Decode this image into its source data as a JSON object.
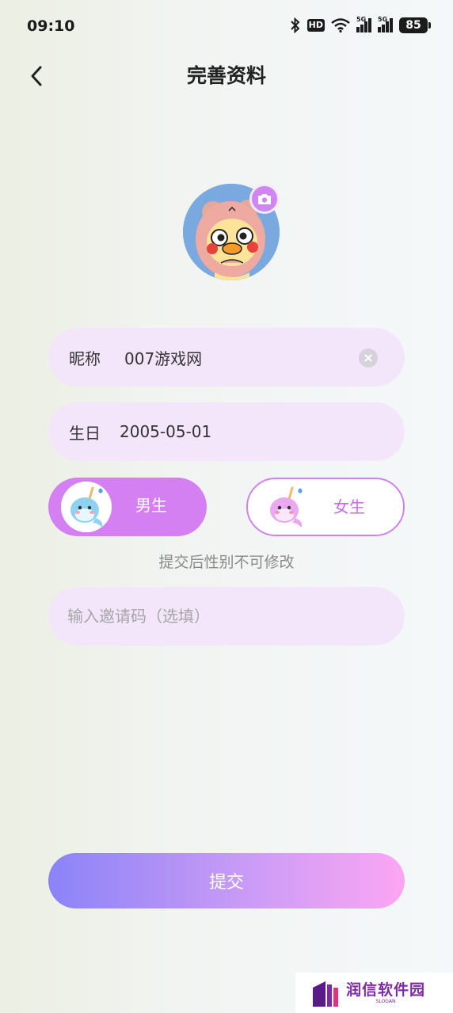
{
  "status_bar": {
    "time": "09:10",
    "hd_label": "HD",
    "network_1": "5G",
    "network_2": "5G",
    "battery": "85"
  },
  "header": {
    "title": "完善资料",
    "back_icon": "chevron-left-icon"
  },
  "avatar": {
    "badge_icon": "camera-icon",
    "badge_color": "#cf86f1"
  },
  "form": {
    "nickname_label": "昵称",
    "nickname_value": "007游戏网",
    "birthday_label": "生日",
    "birthday_value": "2005-05-01",
    "male_label": "男生",
    "female_label": "女生",
    "selected_gender": "男生",
    "gender_hint": "提交后性别不可修改",
    "invite_placeholder": "输入邀请码（选填）",
    "submit_label": "提交"
  },
  "colors": {
    "accent": "#d47ff2",
    "field_bg": "#f3e6fb",
    "submit_gradient_start": "#8b83f7",
    "submit_gradient_end": "#fca6f3"
  },
  "watermark": {
    "title": "润信软件园",
    "slogan": "SLOGAN"
  }
}
